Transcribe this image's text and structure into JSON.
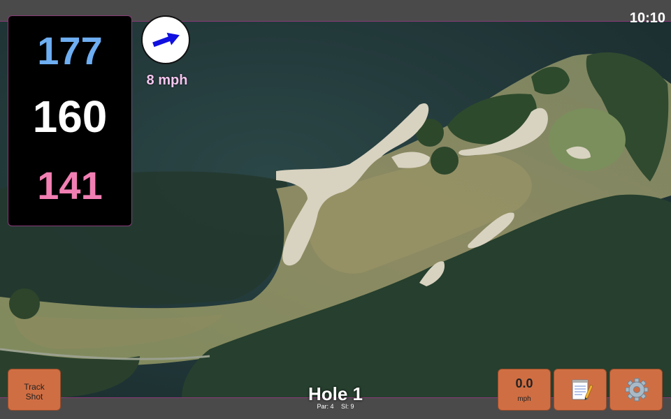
{
  "status": {
    "time": "10:10"
  },
  "yardages": {
    "back": "177",
    "middle": "160",
    "front": "141"
  },
  "wind": {
    "speed": "8 mph",
    "icon": "wind-arrow-icon",
    "arrow_color": "#1010e0"
  },
  "hole": {
    "title": "Hole 1",
    "par": "Par: 4",
    "si": "SI: 9"
  },
  "buttons": {
    "track_shot": {
      "line1": "Track",
      "line2": "Shot"
    },
    "speed": {
      "value": "0.0",
      "unit": "mph"
    },
    "notes": {
      "icon": "notepad-icon"
    },
    "settings": {
      "icon": "gear-icon"
    }
  },
  "colors": {
    "back_yardage": "#6eaef2",
    "middle_yardage": "#ffffff",
    "front_yardage": "#f27fb3",
    "button_orange": "#d06e43",
    "accent_purple": "#8a3a78"
  },
  "map": {
    "kind": "satellite-golf-hole"
  }
}
